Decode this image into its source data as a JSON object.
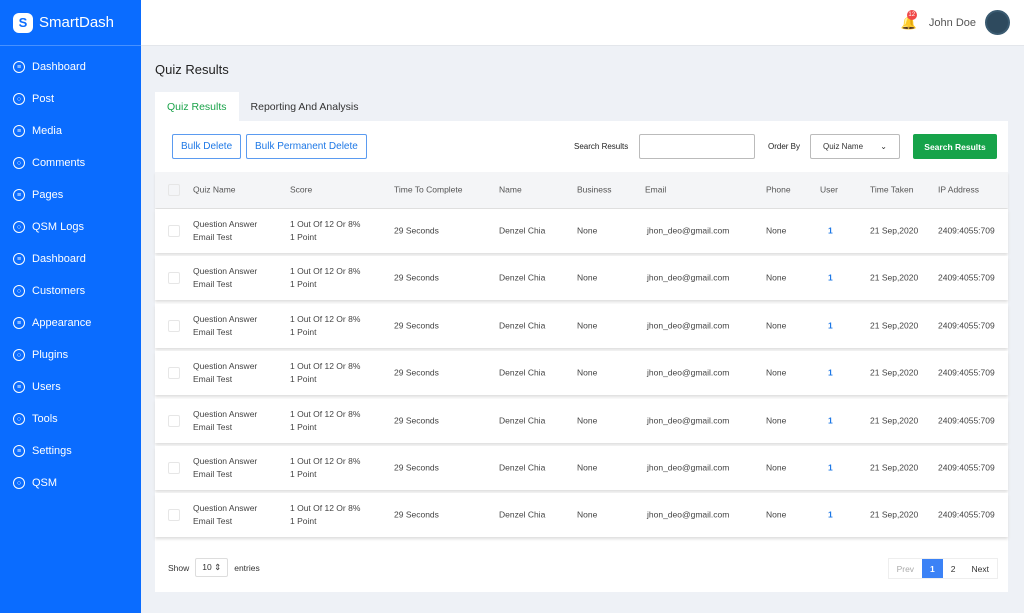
{
  "brand": {
    "name": "SmartDash",
    "logo_letter": "S"
  },
  "sidebar": {
    "items": [
      {
        "label": "Dashboard",
        "icon": "list-icon"
      },
      {
        "label": "Post",
        "icon": "user-icon"
      },
      {
        "label": "Media",
        "icon": "list-icon"
      },
      {
        "label": "Comments",
        "icon": "user-icon"
      },
      {
        "label": "Pages",
        "icon": "list-icon"
      },
      {
        "label": "QSM Logs",
        "icon": "user-icon"
      },
      {
        "label": "Dashboard",
        "icon": "list-icon"
      },
      {
        "label": "Customers",
        "icon": "user-icon"
      },
      {
        "label": "Appearance",
        "icon": "list-icon"
      },
      {
        "label": "Plugins",
        "icon": "user-icon"
      },
      {
        "label": "Users",
        "icon": "list-icon"
      },
      {
        "label": "Tools",
        "icon": "user-icon"
      },
      {
        "label": "Settings",
        "icon": "list-icon"
      },
      {
        "label": "QSM",
        "icon": "user-icon"
      }
    ]
  },
  "header": {
    "notifications": "12",
    "user_name": "John Doe"
  },
  "page": {
    "title": "Quiz Results",
    "tabs": [
      "Quiz Results",
      "Reporting And Analysis"
    ]
  },
  "toolbar": {
    "bulk_delete": "Bulk Delete",
    "bulk_permanent_delete": "Bulk Permanent Delete",
    "search_label": "Search Results",
    "search_value": "",
    "order_label": "Order By",
    "order_value": "Quiz Name",
    "search_button": "Search Results"
  },
  "table": {
    "columns": [
      "Quiz Name",
      "Score",
      "Time To Complete",
      "Name",
      "Business",
      "Email",
      "Phone",
      "User",
      "Time Taken",
      "IP Address"
    ],
    "rows": [
      {
        "quiz1": "Question Answer",
        "quiz2": "Email Test",
        "score1": "1 Out Of 12 Or 8%",
        "score2": "1 Point",
        "time": "29 Seconds",
        "name": "Denzel Chia",
        "business": "None",
        "email": "jhon_deo@gmail.com",
        "phone": "None",
        "user": "1",
        "taken": "21 Sep,2020",
        "ip": "2409:4055:709"
      },
      {
        "quiz1": "Question Answer",
        "quiz2": "Email Test",
        "score1": "1 Out Of 12 Or 8%",
        "score2": "1 Point",
        "time": "29 Seconds",
        "name": "Denzel Chia",
        "business": "None",
        "email": "jhon_deo@gmail.com",
        "phone": "None",
        "user": "1",
        "taken": "21 Sep,2020",
        "ip": "2409:4055:709"
      },
      {
        "quiz1": "Question Answer",
        "quiz2": "Email Test",
        "score1": "1 Out Of 12 Or 8%",
        "score2": "1 Point",
        "time": "29 Seconds",
        "name": "Denzel Chia",
        "business": "None",
        "email": "jhon_deo@gmail.com",
        "phone": "None",
        "user": "1",
        "taken": "21 Sep,2020",
        "ip": "2409:4055:709"
      },
      {
        "quiz1": "Question Answer",
        "quiz2": "Email Test",
        "score1": "1 Out Of 12 Or 8%",
        "score2": "1 Point",
        "time": "29 Seconds",
        "name": "Denzel Chia",
        "business": "None",
        "email": "jhon_deo@gmail.com",
        "phone": "None",
        "user": "1",
        "taken": "21 Sep,2020",
        "ip": "2409:4055:709"
      },
      {
        "quiz1": "Question Answer",
        "quiz2": "Email Test",
        "score1": "1 Out Of 12 Or 8%",
        "score2": "1 Point",
        "time": "29 Seconds",
        "name": "Denzel Chia",
        "business": "None",
        "email": "jhon_deo@gmail.com",
        "phone": "None",
        "user": "1",
        "taken": "21 Sep,2020",
        "ip": "2409:4055:709"
      },
      {
        "quiz1": "Question Answer",
        "quiz2": "Email Test",
        "score1": "1 Out Of 12 Or 8%",
        "score2": "1 Point",
        "time": "29 Seconds",
        "name": "Denzel Chia",
        "business": "None",
        "email": "jhon_deo@gmail.com",
        "phone": "None",
        "user": "1",
        "taken": "21 Sep,2020",
        "ip": "2409:4055:709"
      },
      {
        "quiz1": "Question Answer",
        "quiz2": "Email Test",
        "score1": "1 Out Of 12 Or 8%",
        "score2": "1 Point",
        "time": "29 Seconds",
        "name": "Denzel Chia",
        "business": "None",
        "email": "jhon_deo@gmail.com",
        "phone": "None",
        "user": "1",
        "taken": "21 Sep,2020",
        "ip": "2409:4055:709"
      }
    ]
  },
  "footer": {
    "show": "Show",
    "entries_value": "10",
    "entries": "entries",
    "prev": "Prev",
    "pages": [
      "1",
      "2"
    ],
    "next": "Next"
  },
  "colors": {
    "sidebar": "#0a6cff",
    "accent_green": "#16a34a",
    "link_blue": "#1e78e6"
  }
}
